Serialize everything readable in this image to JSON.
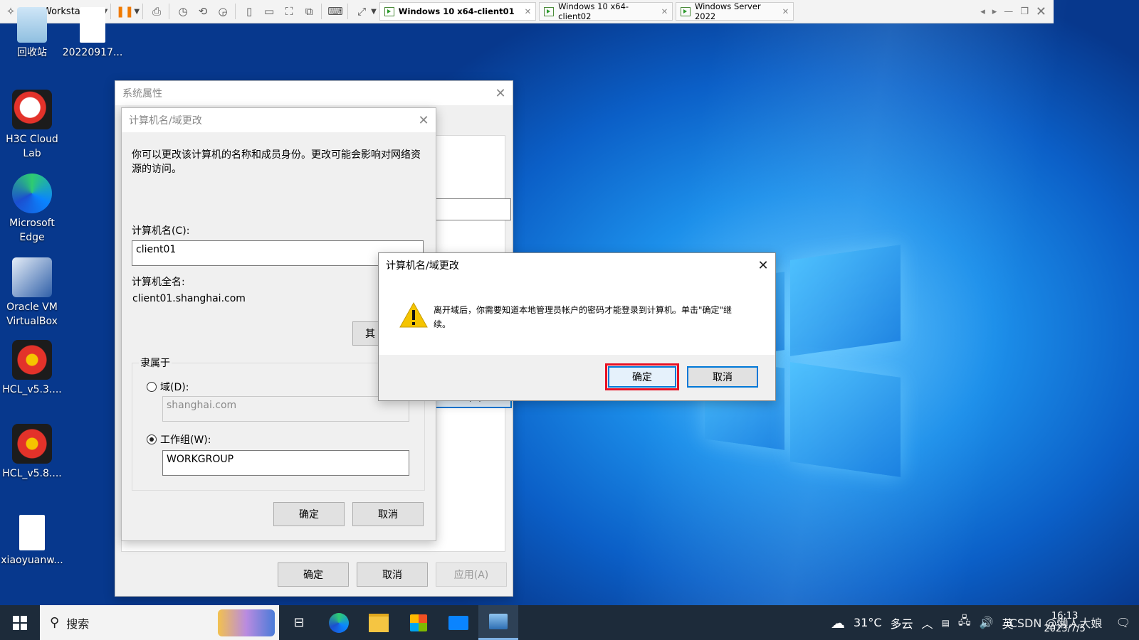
{
  "vmware": {
    "product": "Workstation",
    "tabs": [
      {
        "label": "Windows 10 x64-client01",
        "active": true
      },
      {
        "label": "Windows 10 x64-client02",
        "active": false
      },
      {
        "label": "Windows Server 2022",
        "active": false
      }
    ]
  },
  "desktop_icons": [
    {
      "label": "回收站",
      "icon": "recycle-bin-icon"
    },
    {
      "label": "20220917...",
      "icon": "file-icon"
    },
    {
      "label": "H3C Cloud Lab",
      "icon": "h3c-cloud-lab-icon"
    },
    {
      "label": "Microsoft Edge",
      "icon": "edge-icon"
    },
    {
      "label": "Oracle VM VirtualBox",
      "icon": "virtualbox-icon"
    },
    {
      "label": "HCL_v5.3....",
      "icon": "hcl-icon"
    },
    {
      "label": "HCL_v5.8....",
      "icon": "hcl-icon"
    },
    {
      "label": "xiaoyuanw...",
      "icon": "file-icon"
    }
  ],
  "system_properties": {
    "title": "系统属性",
    "ok": "确定",
    "cancel": "取消",
    "apply": "应用(A)",
    "partial_button": "t(C)..."
  },
  "computer_name_dialog": {
    "title": "计算机名/域更改",
    "description": "你可以更改该计算机的名称和成员身份。更改可能会影响对网络资源的访问。",
    "computer_name_label": "计算机名(C):",
    "computer_name_value": "client01",
    "full_name_label": "计算机全名:",
    "full_name_value": "client01.shanghai.com",
    "other_button": "其",
    "member_of_label": "隶属于",
    "domain_label": "域(D):",
    "domain_value": "shanghai.com",
    "workgroup_label": "工作组(W):",
    "workgroup_value": "WORKGROUP",
    "ok": "确定",
    "cancel": "取消"
  },
  "confirm_dialog": {
    "title": "计算机名/域更改",
    "message": "离开域后，你需要知道本地管理员帐户的密码才能登录到计算机。单击\"确定\"继续。",
    "ok": "确定",
    "cancel": "取消"
  },
  "taskbar": {
    "search_placeholder": "搜索",
    "weather_temp": "31°C",
    "weather_desc": "多云",
    "ime": "英",
    "time": "16:13",
    "date": "2023/7/5",
    "watermark": "CSDN @懒人大娘"
  },
  "colors": {
    "highlight_red": "#e81123",
    "accent_blue": "#0078d7"
  }
}
